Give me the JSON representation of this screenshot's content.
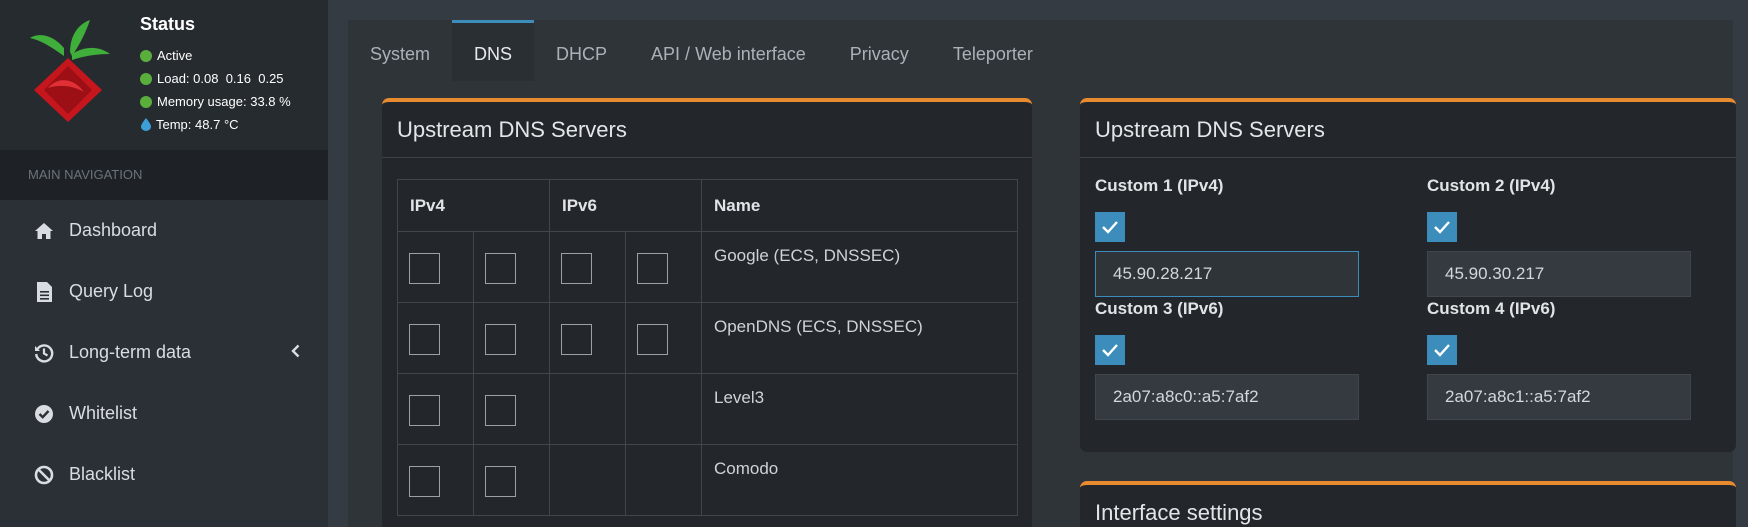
{
  "sidebar": {
    "status": {
      "title": "Status",
      "active": "Active",
      "load_label": "Load:",
      "load_values": "0.08  0.16  0.25",
      "memory_label": "Memory usage:",
      "memory_value": "33.8 %",
      "temp_label": "Temp:",
      "temp_value": "48.7 °C"
    },
    "nav_header": "MAIN NAVIGATION",
    "items": [
      {
        "label": "Dashboard",
        "icon": "home-icon"
      },
      {
        "label": "Query Log",
        "icon": "document-icon"
      },
      {
        "label": "Long-term data",
        "icon": "history-icon"
      },
      {
        "label": "Whitelist",
        "icon": "check-circle-icon"
      },
      {
        "label": "Blacklist",
        "icon": "ban-icon"
      }
    ]
  },
  "tabs": [
    "System",
    "DNS",
    "DHCP",
    "API / Web interface",
    "Privacy",
    "Teleporter"
  ],
  "active_tab": "DNS",
  "upstream": {
    "title": "Upstream DNS Servers",
    "col_ipv4": "IPv4",
    "col_ipv6": "IPv6",
    "col_name": "Name",
    "rows": [
      {
        "name": "Google (ECS, DNSSEC)"
      },
      {
        "name": "OpenDNS (ECS, DNSSEC)"
      },
      {
        "name": "Level3"
      },
      {
        "name": "Comodo"
      }
    ]
  },
  "custom": {
    "title": "Upstream DNS Servers",
    "c1_label": "Custom 1 (IPv4)",
    "c1_value": "45.90.28.217",
    "c2_label": "Custom 2 (IPv4)",
    "c2_value": "45.90.30.217",
    "c3_label": "Custom 3 (IPv6)",
    "c3_value": "2a07:a8c0::a5:7af2",
    "c4_label": "Custom 4 (IPv6)",
    "c4_value": "2a07:a8c1::a5:7af2"
  },
  "interface": {
    "title": "Interface settings"
  },
  "colors": {
    "accent_blue": "#3c8dbc",
    "accent_orange": "#e88a2f",
    "status_green": "#5aae3c"
  }
}
